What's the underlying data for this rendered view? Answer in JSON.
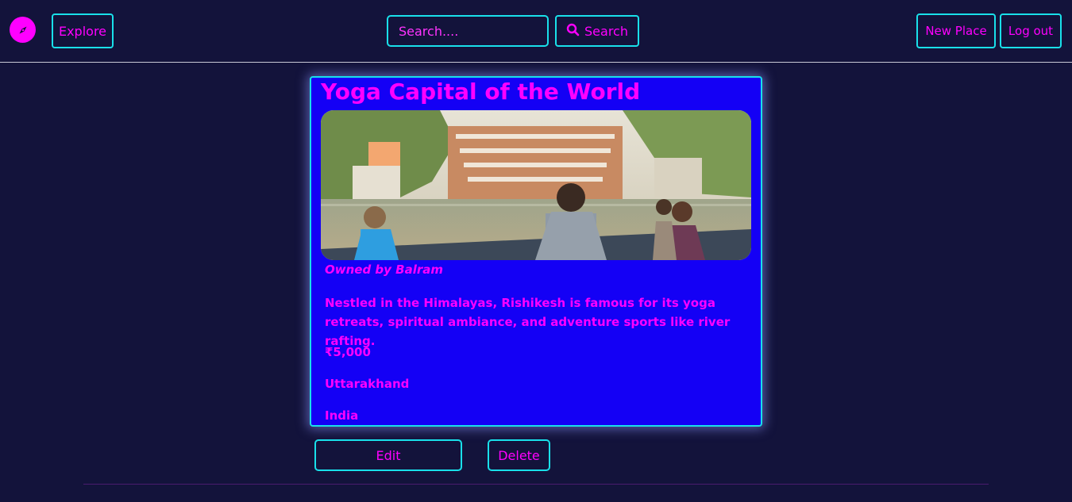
{
  "nav": {
    "explore_label": "Explore",
    "search_placeholder": "Search....",
    "search_label": "Search",
    "new_place_label": "New Place",
    "logout_label": "Log out"
  },
  "listing": {
    "title": "Yoga Capital of the World",
    "owner": "Owned by Balram",
    "description": "Nestled in the Himalayas, Rishikesh is famous for its yoga retreats, spiritual ambiance, and adventure sports like river rafting.",
    "price": "₹5,000",
    "location": "Uttarakhand",
    "country": "India"
  },
  "actions": {
    "edit_label": "Edit",
    "delete_label": "Delete"
  },
  "icons": {
    "logo": "compass-icon",
    "search": "search-icon"
  },
  "colors": {
    "background": "#13133b",
    "accent": "#ff00ff",
    "border": "#19e0ea",
    "card": "#1400f5"
  }
}
